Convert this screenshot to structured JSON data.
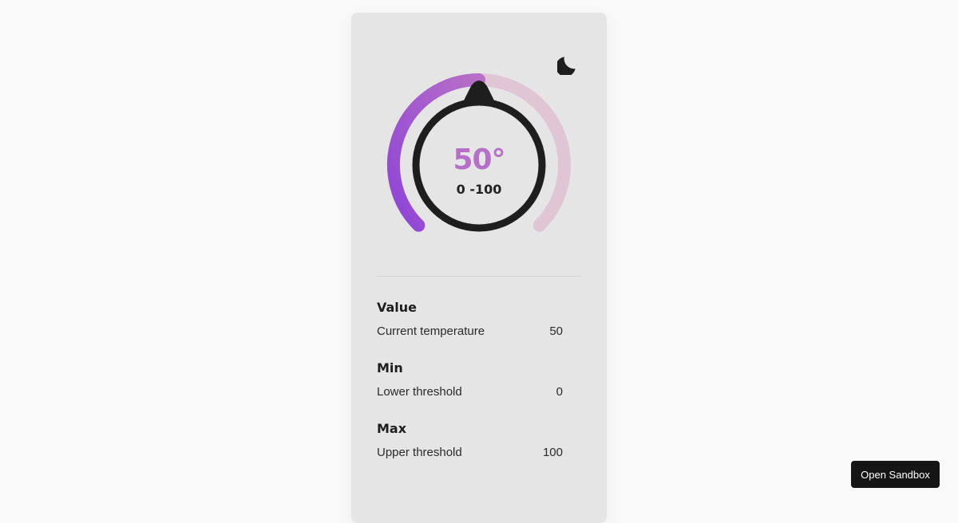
{
  "thermostat": {
    "value_text": "50°",
    "range_text": "0 -100",
    "value": 50,
    "min": 0,
    "max": 100,
    "colors": {
      "gradient_start": "#8e44d6",
      "gradient_end": "#b86fc6",
      "track": "#e0c6d4",
      "knob": "#1e1e1e",
      "value_text": "#b770c8"
    }
  },
  "theme_toggle": {
    "icon": "moon-icon"
  },
  "params": [
    {
      "name": "Value",
      "description": "Current temperature",
      "value": "50"
    },
    {
      "name": "Min",
      "description": "Lower threshold",
      "value": "0"
    },
    {
      "name": "Max",
      "description": "Upper threshold",
      "value": "100"
    }
  ],
  "footer": {
    "open_sandbox_label": "Open Sandbox"
  }
}
